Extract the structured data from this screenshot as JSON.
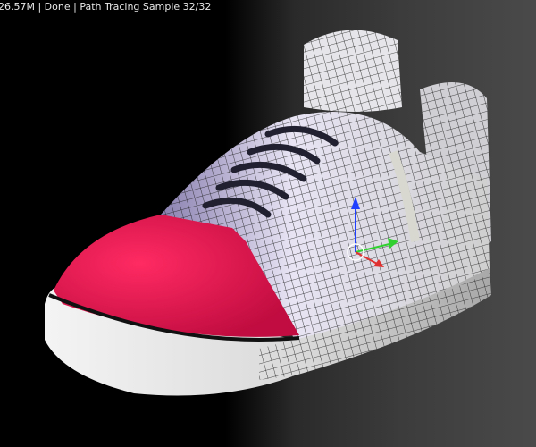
{
  "viewport": {
    "status_text": "26.57M | Done | Path Tracing Sample 32/32",
    "render_samples_done": 32,
    "render_samples_total": 32
  },
  "colors": {
    "toe_cap": "#ff1a5a",
    "sole": "#e8e8e8",
    "upper": "#d8d4e8",
    "gizmo_x": "#e03030",
    "gizmo_y": "#30d030",
    "gizmo_z": "#2040ff"
  }
}
